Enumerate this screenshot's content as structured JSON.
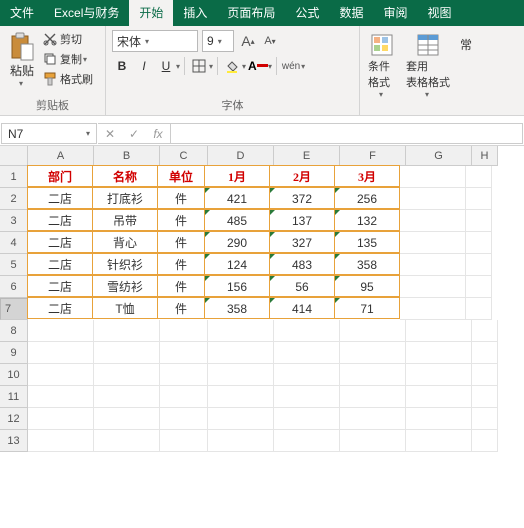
{
  "tabs": {
    "file": "文件",
    "custom": "Excel与财务",
    "home": "开始",
    "insert": "插入",
    "layout": "页面布局",
    "formula": "公式",
    "data": "数据",
    "review": "审阅",
    "view": "视图"
  },
  "ribbon": {
    "paste": "粘贴",
    "cut": "剪切",
    "copy": "复制",
    "format_painter": "格式刷",
    "clipboard": "剪贴板",
    "font_name": "宋体",
    "font_size": "9",
    "bold": "B",
    "italic": "I",
    "underline": "U",
    "wen": "wén",
    "font_group": "字体",
    "cond_format": "条件格式",
    "table_format": "套用\n表格格式",
    "normal": "常"
  },
  "namebox": "N7",
  "fx": "fx",
  "cols": [
    "A",
    "B",
    "C",
    "D",
    "E",
    "F",
    "G",
    "H"
  ],
  "rows": [
    "1",
    "2",
    "3",
    "4",
    "5",
    "6",
    "7",
    "8",
    "9",
    "10",
    "11",
    "12",
    "13"
  ],
  "chart_data": {
    "type": "table",
    "headers": [
      "部门",
      "名称",
      "单位",
      "1月",
      "2月",
      "3月"
    ],
    "data": [
      [
        "二店",
        "打底衫",
        "件",
        421,
        372,
        256
      ],
      [
        "二店",
        "吊带",
        "件",
        485,
        137,
        132
      ],
      [
        "二店",
        "背心",
        "件",
        290,
        327,
        135
      ],
      [
        "二店",
        "针织衫",
        "件",
        124,
        483,
        358
      ],
      [
        "二店",
        "雪纺衫",
        "件",
        156,
        56,
        95
      ],
      [
        "二店",
        "T恤",
        "件",
        358,
        414,
        71
      ]
    ]
  },
  "selected": {
    "row": 7,
    "col": "N"
  }
}
